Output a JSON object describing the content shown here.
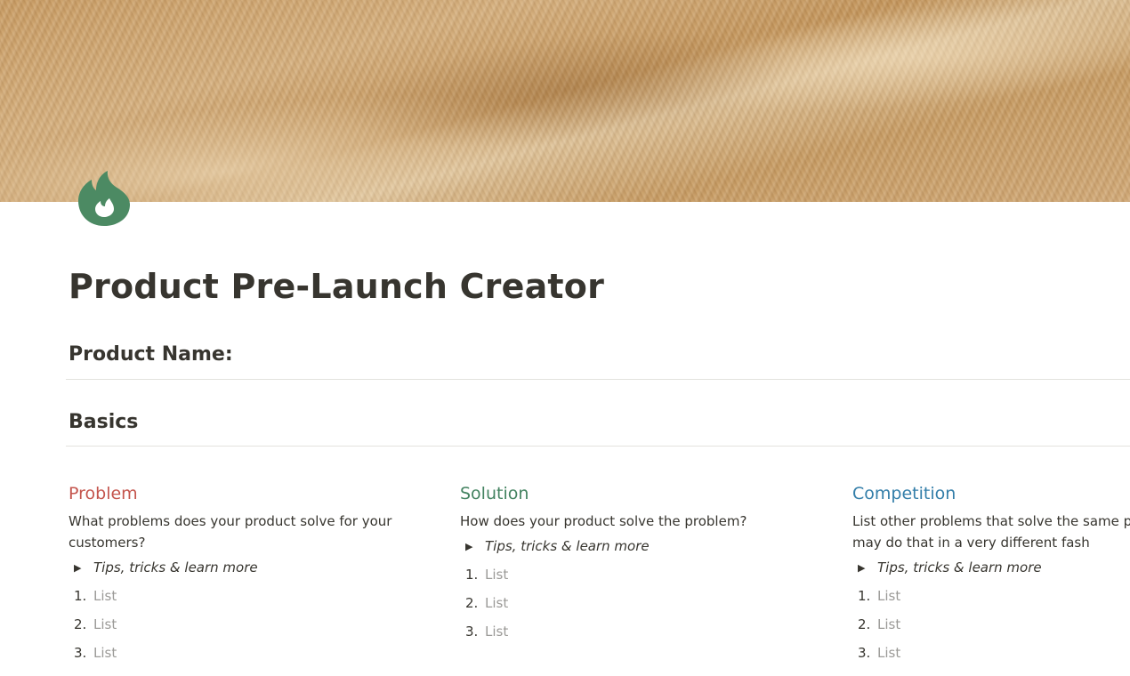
{
  "page": {
    "title": "Product Pre-Launch Creator",
    "icon": "flame-icon",
    "icon_color": "#4c8a63"
  },
  "sections": {
    "product_name_heading": "Product Name:",
    "basics_heading": "Basics"
  },
  "columns": [
    {
      "heading": "Problem",
      "color": "#c4554d",
      "description": "What problems does your product solve for your customers?",
      "toggle_label": "Tips, tricks & learn more",
      "list": [
        {
          "number": "1.",
          "placeholder": "List"
        },
        {
          "number": "2.",
          "placeholder": "List"
        },
        {
          "number": "3.",
          "placeholder": "List"
        }
      ]
    },
    {
      "heading": "Solution",
      "color": "#448361",
      "description": "How does your product solve the problem?",
      "toggle_label": "Tips, tricks & learn more",
      "list": [
        {
          "number": "1.",
          "placeholder": "List"
        },
        {
          "number": "2.",
          "placeholder": "List"
        },
        {
          "number": "3.",
          "placeholder": "List"
        }
      ]
    },
    {
      "heading": "Competition",
      "color": "#337ea9",
      "description": "List other problems that solve the same prob that they may do that in a very different fash",
      "toggle_label": "Tips, tricks & learn more",
      "list": [
        {
          "number": "1.",
          "placeholder": "List"
        },
        {
          "number": "2.",
          "placeholder": "List"
        },
        {
          "number": "3.",
          "placeholder": "List"
        }
      ]
    }
  ],
  "glyphs": {
    "toggle_collapsed": "▶"
  }
}
